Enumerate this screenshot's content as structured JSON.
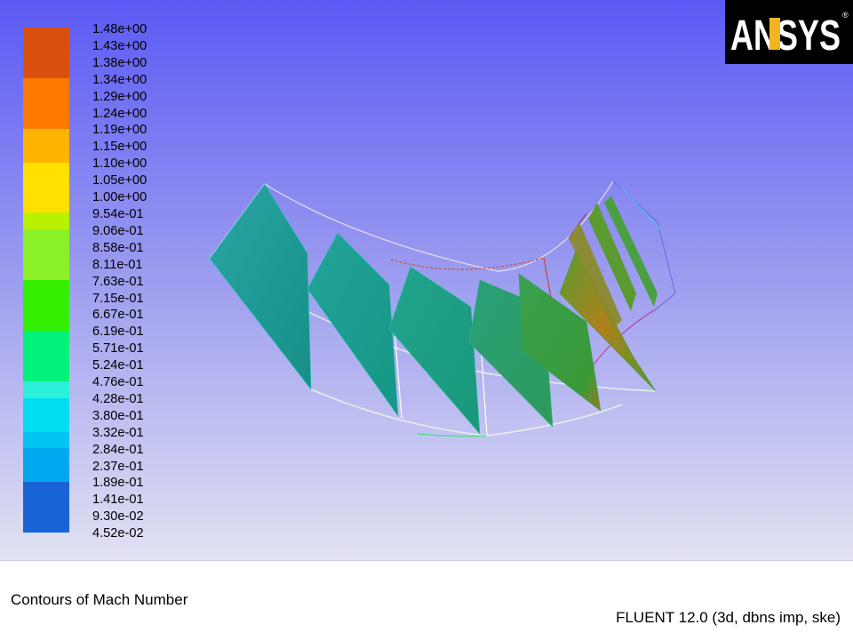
{
  "legend": {
    "labels": [
      "1.48e+00",
      "1.43e+00",
      "1.38e+00",
      "1.34e+00",
      "1.29e+00",
      "1.24e+00",
      "1.19e+00",
      "1.15e+00",
      "1.10e+00",
      "1.05e+00",
      "1.00e+00",
      "9.54e-01",
      "9.06e-01",
      "8.58e-01",
      "8.11e-01",
      "7.63e-01",
      "7.15e-01",
      "6.67e-01",
      "6.19e-01",
      "5.71e-01",
      "5.24e-01",
      "4.76e-01",
      "4.28e-01",
      "3.80e-01",
      "3.32e-01",
      "2.84e-01",
      "2.37e-01",
      "1.89e-01",
      "1.41e-01",
      "9.30e-02",
      "4.52e-02"
    ],
    "band_colors": [
      "#d9500e",
      "#d9500e",
      "#d9500e",
      "#ff7a00",
      "#ff7a00",
      "#ff7a00",
      "#ffb400",
      "#ffb400",
      "#ffe000",
      "#ffe000",
      "#ffe000",
      "#b8f200",
      "#8af028",
      "#8af028",
      "#8af028",
      "#33ee00",
      "#33ee00",
      "#33ee00",
      "#00f07c",
      "#00f07c",
      "#00f07c",
      "#2ef0d8",
      "#00dcf0",
      "#00dcf0",
      "#00c4f2",
      "#00a8f0",
      "#00a8f0",
      "#1864d6",
      "#1864d6",
      "#1864d6"
    ]
  },
  "logo": {
    "text": "ANSYS",
    "mark": "®"
  },
  "footer": {
    "title": "Contours of Mach Number",
    "solver": "FLUENT 12.0 (3d, dbns imp, ske)"
  },
  "colors": {
    "bg_top": "#5a5af4",
    "bg_bottom": "#e2e2f3",
    "blade_cyan": "#20a59a",
    "blade_teal": "#1a9c88",
    "blade_green": "#3a9e3a",
    "blade_hot": "#c07a1a"
  }
}
